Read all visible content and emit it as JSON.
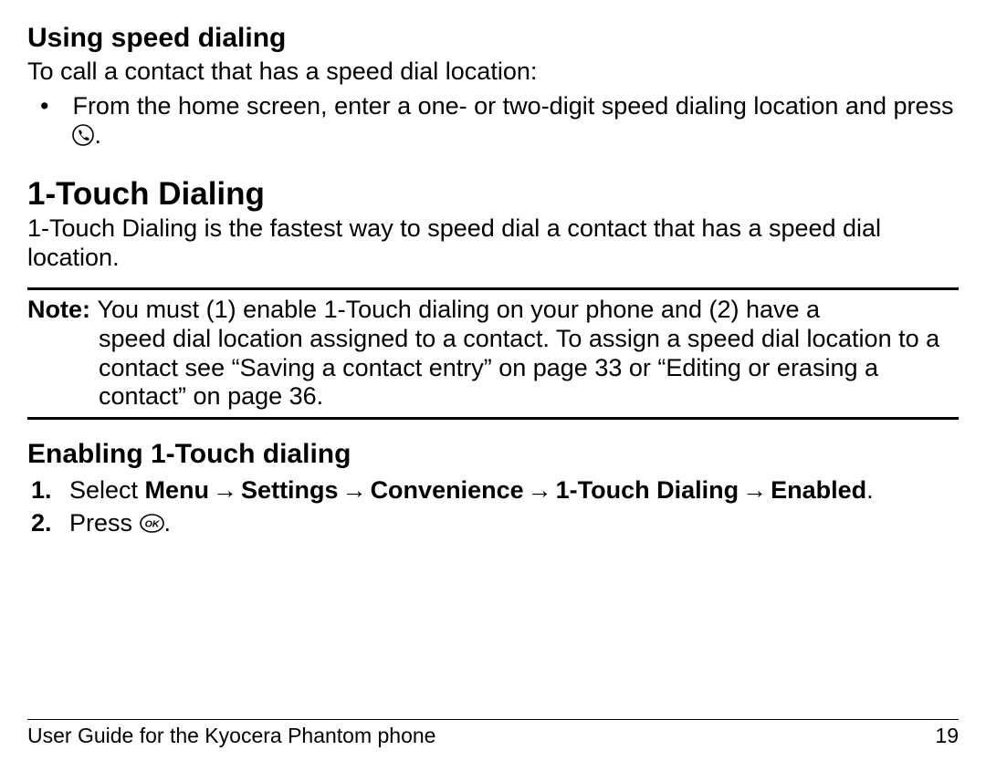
{
  "section1": {
    "title": "Using speed dialing",
    "intro": "To call a contact that has a speed dial location:",
    "bullet_before": "From the home screen, enter a one- or two-digit speed dialing location and press ",
    "bullet_after": "."
  },
  "section2": {
    "title": "1-Touch Dialing",
    "desc": "1-Touch Dialing is the fastest way to speed dial a contact that has a speed dial location."
  },
  "note": {
    "label": "Note: ",
    "line1": "You must (1) enable 1-Touch dialing on your phone and (2) have a",
    "rest": "speed dial location assigned to a contact. To assign a speed dial location to a contact see “Saving a contact entry” on page 33 or “Editing or erasing a contact” on page 36."
  },
  "section3": {
    "title": "Enabling 1-Touch dialing",
    "step1": {
      "num": "1.",
      "prefix": "Select ",
      "path": [
        "Menu",
        "Settings",
        "Convenience",
        "1-Touch Dialing",
        "Enabled"
      ],
      "suffix": "."
    },
    "step2": {
      "num": "2.",
      "prefix": "Press ",
      "suffix": "."
    }
  },
  "footer": {
    "left": "User Guide for the Kyocera Phantom phone",
    "right": "19"
  },
  "arrow": "→"
}
